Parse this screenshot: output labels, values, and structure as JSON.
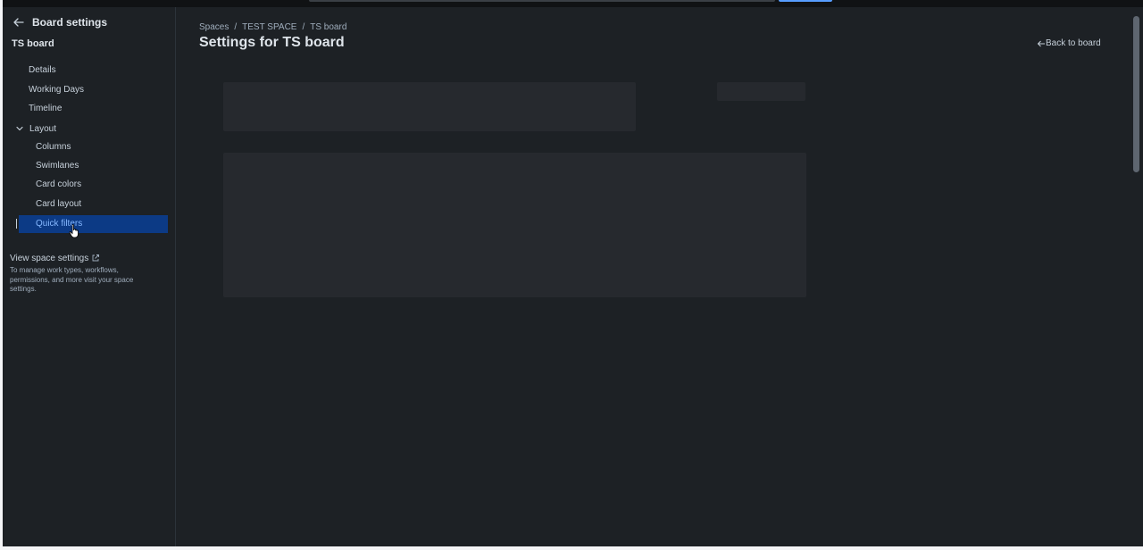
{
  "sidebar": {
    "title": "Board settings",
    "board_name": "TS board",
    "items": [
      {
        "label": "Details"
      },
      {
        "label": "Working Days"
      },
      {
        "label": "Timeline"
      }
    ],
    "layout": {
      "label": "Layout",
      "children": [
        {
          "label": "Columns"
        },
        {
          "label": "Swimlanes"
        },
        {
          "label": "Card colors"
        },
        {
          "label": "Card layout"
        },
        {
          "label": "Quick filters"
        }
      ]
    },
    "view_space_settings": {
      "label": "View space settings",
      "description": "To manage work types, workflows, permissions, and more visit your space settings."
    }
  },
  "main": {
    "breadcrumb": [
      "Spaces",
      "TEST SPACE",
      "TS board"
    ],
    "breadcrumb_separator": "/",
    "title": "Settings for TS board",
    "back_link": "Back to board"
  },
  "colors": {
    "background": "#1d2125",
    "active_nav_bg": "#0c3a85",
    "active_nav_text": "#85b8ff",
    "skeleton": "#26292e"
  },
  "icons": {
    "back": "arrow-left-icon",
    "layout_toggle": "chevron-down-icon",
    "external": "external-link-icon"
  }
}
